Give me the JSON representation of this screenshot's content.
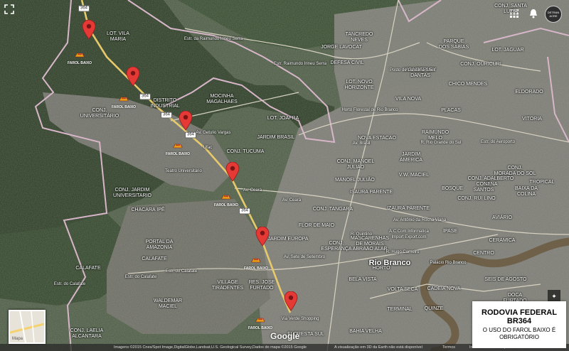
{
  "colors": {
    "accent_pin": "#e53935",
    "farol_car": "#e8a317",
    "road_federal": "#e6c96b",
    "boundary": "#d7b6c9",
    "water": "#6f6149"
  },
  "icons": {
    "fullscreen": "fullscreen-icon",
    "apps": "grid-icon",
    "notifications": "bell-icon",
    "pin": "map-pin-icon",
    "car": "car-icon",
    "compass": "compass-icon"
  },
  "map_labels": [
    {
      "text": "LOT. VILA\nMARIA"
    },
    {
      "text": "DISTRITO\nINDUSTRIAL"
    },
    {
      "text": "CONJ.\nUNIVERSITÁRIO"
    },
    {
      "text": "MOCINHA\nMAGALHAES"
    },
    {
      "text": "LOT. JOAFRA"
    },
    {
      "text": "JARDIM BRASIL"
    },
    {
      "text": "CONJ. TUCUMA"
    },
    {
      "text": "CONJ. JARDIM\nUNIVERSITARIO"
    },
    {
      "text": "CHACARA IPÊ"
    },
    {
      "text": "PORTAL DA\nAMAZONIA"
    },
    {
      "text": "CALAFATE"
    },
    {
      "text": "CALAFATE"
    },
    {
      "text": "WALDEMAR\nMACIEL"
    },
    {
      "text": "CONJ. LAELIA\nALCANTARA"
    },
    {
      "text": "VILLAGE\nTIRADENTES"
    },
    {
      "text": "RES. JOSE\nFURTADO"
    },
    {
      "text": "JARDIM EUROPA"
    },
    {
      "text": "CONJ.\nESPERANÇA"
    },
    {
      "text": "MASCARENHAS\nDE MORAIS"
    },
    {
      "text": "ABRAAO ALAB"
    },
    {
      "text": "CONJ. TANGARA"
    },
    {
      "text": "CONJ. MANOEL\nJULIAO"
    },
    {
      "text": "MANOEL JULIÃO"
    },
    {
      "text": "FLOR DE MAIO"
    },
    {
      "text": "ISAURA PARENTE"
    },
    {
      "text": "IZAURA PARENTE"
    },
    {
      "text": "V.W. MACIEL"
    },
    {
      "text": "JARDIM\nAMERICA"
    },
    {
      "text": "NOVA ESTACAO"
    },
    {
      "text": "RAIMUNDO\nMELO"
    },
    {
      "text": "PLACAS"
    },
    {
      "text": "VILA NOVA"
    },
    {
      "text": "LOT. NOVO\nHORIZONTE"
    },
    {
      "text": "DEFESA CIVIL"
    },
    {
      "text": "JORGE LAVOCAT"
    },
    {
      "text": "TANCREDO\nNEVES"
    },
    {
      "text": "CONJ. SANTA\nLUZIA"
    },
    {
      "text": "PARQUE\nDOS SABIAS"
    },
    {
      "text": "LOT. JAGUAR"
    },
    {
      "text": "CONJ. OURICURI"
    },
    {
      "text": "WANDERLEY\nDANTAS"
    },
    {
      "text": "CHICO MENDES"
    },
    {
      "text": "ELDORADO"
    },
    {
      "text": "VITORIA"
    },
    {
      "text": "CONJ.\nMORADA DO SOL"
    },
    {
      "text": "CONJ. ADALBERTO\nSENA"
    },
    {
      "text": "CONJ. RUI LINO"
    },
    {
      "text": "BOSQUE"
    },
    {
      "text": "CONJ.\nSANTOS"
    },
    {
      "text": "BAIXA DA\nCOLINA"
    },
    {
      "text": "TROPICAL"
    },
    {
      "text": "AVIÁRIO"
    },
    {
      "text": "IPASE"
    },
    {
      "text": "CENTRO"
    },
    {
      "text": "CERAMICA"
    },
    {
      "text": "CADEIA NOVA"
    },
    {
      "text": "VOLTA SECA"
    },
    {
      "text": "BELA VISTA"
    },
    {
      "text": "BAHIA VELHA"
    },
    {
      "text": "QUINZE"
    },
    {
      "text": "SEIS DE AGOSTO"
    },
    {
      "text": "DOCA\nFURTADO"
    },
    {
      "text": "HORTO"
    },
    {
      "text": "TERMINAL"
    },
    {
      "text": "FLORESTA SUL"
    },
    {
      "text": "HABITASA"
    },
    {
      "text": "Rio Branco"
    }
  ],
  "street_labels": [
    {
      "text": "Estr. da Raimundo Irineu Serra"
    },
    {
      "text": "Estr. Raimundo Irineu Serra"
    },
    {
      "text": "Av. Getulio Vargas"
    },
    {
      "text": "Av. Ceará"
    },
    {
      "text": "Av. Ceará"
    },
    {
      "text": "Av. Sete de Setembro"
    },
    {
      "text": "Estr. do Calafate"
    },
    {
      "text": "Estr. do Calafate"
    },
    {
      "text": "Estr. do Calafate"
    },
    {
      "text": "R. Quintino"
    },
    {
      "text": "R. Hugo Carneiro"
    },
    {
      "text": "Av. Antônio da Rocha Viana"
    },
    {
      "text": "Av. Brasil"
    },
    {
      "text": "R. Rio Grande do Sul"
    },
    {
      "text": "Estr. do Aeroporto"
    }
  ],
  "pois": [
    {
      "text": "Posto de Gasolina Shell"
    },
    {
      "text": "Teatro Universitário"
    },
    {
      "text": "Via Verde Shopping"
    },
    {
      "text": "Horto Florestal de Rio Branco"
    },
    {
      "text": "Palácio Rio Branco"
    },
    {
      "text": "Ufac"
    },
    {
      "text": "A.C.Com Informatica\nImport Export.com"
    }
  ],
  "route_shields": [
    {
      "text": "364"
    },
    {
      "text": "364"
    },
    {
      "text": "364"
    },
    {
      "text": "364"
    },
    {
      "text": "364"
    }
  ],
  "farol_label": "FAROL BAIXO",
  "info_box": {
    "title_line1": "RODOVIA FEDERAL",
    "title_line2": "BR364",
    "subtitle": "O USO DO FAROL BAIXO É OBRIGATÓRIO"
  },
  "controls": {
    "minimap_label": "Mapa",
    "avatar_text": "DETRAN\nACRE",
    "google_logo": "Google"
  },
  "attribution": {
    "imagery": "Imagens ©2015 Cnes/Spot Image,DigitalGlobe,Landsat,U.S. Geological Survey,Dados do mapa ©2015 Google",
    "notice": "A visualização em 3D da Earth não está disponível",
    "terms": "Termos",
    "report": "Informar erro no mapa"
  }
}
